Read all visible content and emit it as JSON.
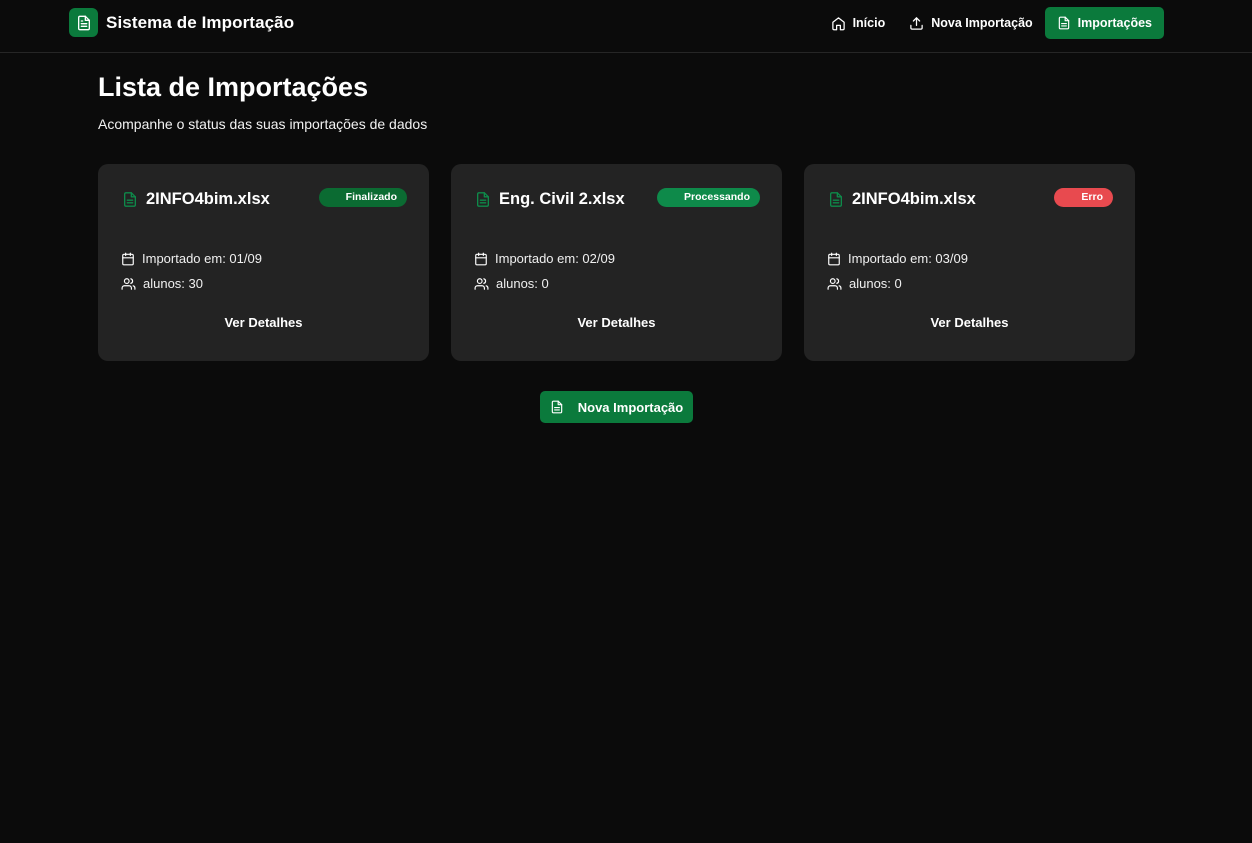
{
  "app": {
    "title": "Sistema de Importação"
  },
  "nav": {
    "items": [
      {
        "label": "Início",
        "icon": "home-icon",
        "active": false
      },
      {
        "label": "Nova Importação",
        "icon": "upload-icon",
        "active": false
      },
      {
        "label": "Importações",
        "icon": "file-text-icon",
        "active": true
      }
    ]
  },
  "page": {
    "title": "Lista de Importações",
    "subtitle": "Acompanhe o status das suas importações de dados"
  },
  "cards": [
    {
      "file_name": "2INFO4bim.xlsx",
      "status": "Finalizado",
      "status_color": "#0b6b32",
      "imported_on": "Importado em: 01/09",
      "students": "alunos: 30",
      "action": "Ver Detalhes"
    },
    {
      "file_name": "Eng. Civil 2.xlsx",
      "status": "Processando",
      "status_color": "#0e8a4a",
      "imported_on": "Importado em: 02/09",
      "students": "alunos: 0",
      "action": "Ver Detalhes"
    },
    {
      "file_name": "2INFO4bim.xlsx",
      "status": "Erro",
      "status_color": "#e84a4f",
      "imported_on": "Importado em: 03/09",
      "students": "alunos: 0",
      "action": "Ver Detalhes"
    }
  ],
  "actions": {
    "new_import_label": "Nova Importação"
  },
  "colors": {
    "accent": "#0b7a3c",
    "background": "#0b0b0b",
    "card": "#232323",
    "error": "#e84a4f"
  }
}
